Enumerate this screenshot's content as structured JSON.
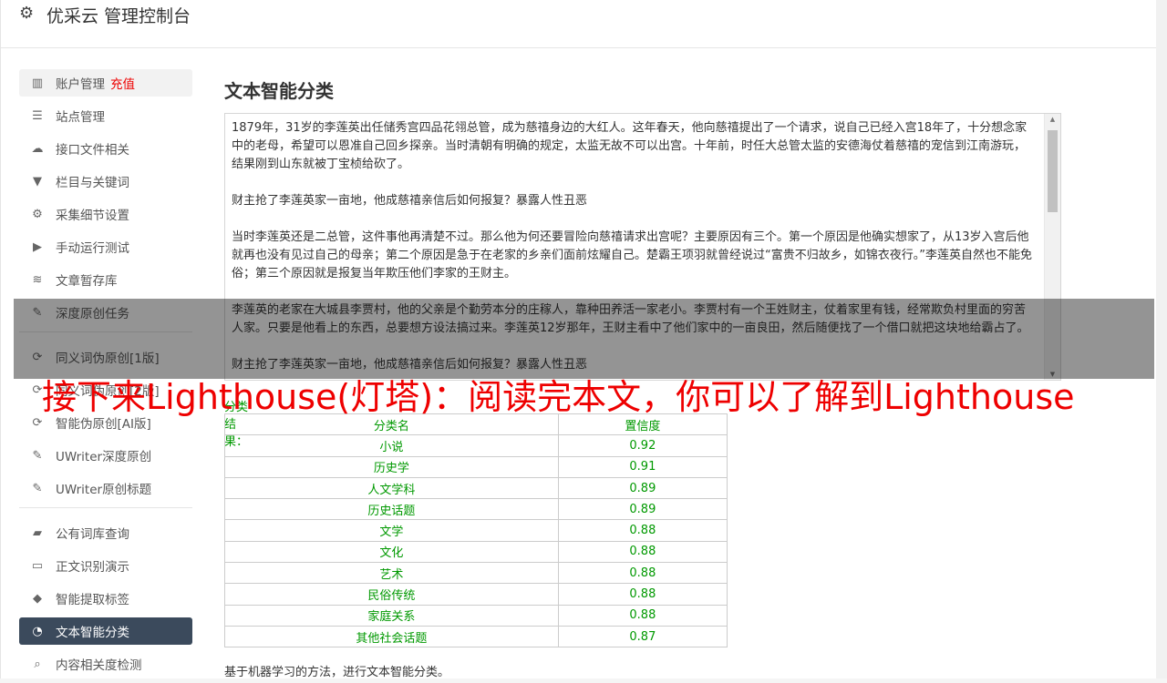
{
  "header": {
    "title": "优采云 管理控制台",
    "icon": "gear-icon"
  },
  "sidebar": {
    "groups": [
      [
        {
          "label": "账户管理",
          "badge": "充值",
          "icon": "bar-chart-icon",
          "state": "hover"
        },
        {
          "label": "站点管理",
          "icon": "server-icon"
        },
        {
          "label": "接口文件相关",
          "icon": "cloud-upload-icon"
        },
        {
          "label": "栏目与关键词",
          "icon": "filter-icon"
        },
        {
          "label": "采集细节设置",
          "icon": "gears-icon"
        },
        {
          "label": "手动运行测试",
          "icon": "play-circle-icon"
        },
        {
          "label": "文章暂存库",
          "icon": "database-icon"
        },
        {
          "label": "深度原创任务",
          "icon": "edit-icon"
        }
      ],
      [
        {
          "label": "同义词伪原创[1版]",
          "icon": "refresh-icon"
        },
        {
          "label": "同义词伪原创[2版]",
          "icon": "refresh-icon"
        },
        {
          "label": "智能伪原创[AI版]",
          "icon": "refresh-icon"
        },
        {
          "label": "UWriter深度原创",
          "icon": "edit-icon"
        },
        {
          "label": "UWriter原创标题",
          "icon": "edit-icon"
        }
      ],
      [
        {
          "label": "公有词库查询",
          "icon": "book-icon"
        },
        {
          "label": "正文识别演示",
          "icon": "monitor-icon"
        },
        {
          "label": "智能提取标签",
          "icon": "tag-icon"
        },
        {
          "label": "文本智能分类",
          "icon": "pie-chart-icon",
          "state": "active"
        },
        {
          "label": "内容相关度检测",
          "icon": "search-icon"
        }
      ]
    ]
  },
  "main": {
    "title": "文本智能分类",
    "text_paragraphs": [
      "1879年，31岁的李莲英出任储秀宫四品花翎总管，成为慈禧身边的大红人。这年春天，他向慈禧提出了一个请求，说自己已经入宫18年了，十分想念家中的老母，希望可以恩准自己回乡探亲。当时清朝有明确的规定，太监无故不可以出宫。十年前，时任大总管太监的安德海仗着慈禧的宠信到江南游玩，结果刚到山东就被丁宝桢给砍了。",
      "财主抢了李莲英家一亩地，他成慈禧亲信后如何报复？暴露人性丑恶",
      "当时李莲英还是二总管，这件事他再清楚不过。那么他为何还要冒险向慈禧请求出宫呢？主要原因有三个。第一个原因是他确实想家了，从13岁入宫后他就再也没有见过自己的母亲；第二个原因是急于在老家的乡亲们面前炫耀自己。楚霸王项羽就曾经说过“富贵不归故乡，如锦衣夜行。”李莲英自然也不能免俗；第三个原因就是报复当年欺压他们李家的王财主。",
      "李莲英的老家在大城县李贾村，他的父亲是个勤劳本分的庄稼人，靠种田养活一家老小。李贾村有一个王姓财主，仗着家里有钱，经常欺负村里面的穷苦人家。只要是他看上的东西，总要想方设法搞过来。李莲英12岁那年，王财主看中了他们家中的一亩良田，然后随便找了一个借口就把这块地给霸占了。",
      "财主抢了李莲英家一亩地，他成慈禧亲信后如何报复？暴露人性丑恶"
    ],
    "result_label": "分类结果：",
    "table": {
      "headers": [
        "分类名",
        "置信度"
      ],
      "rows": [
        [
          "小说",
          "0.92"
        ],
        [
          "历史学",
          "0.91"
        ],
        [
          "人文学科",
          "0.89"
        ],
        [
          "历史话题",
          "0.89"
        ],
        [
          "文学",
          "0.88"
        ],
        [
          "文化",
          "0.88"
        ],
        [
          "艺术",
          "0.88"
        ],
        [
          "民俗传统",
          "0.88"
        ],
        [
          "家庭关系",
          "0.88"
        ],
        [
          "其他社会话题",
          "0.87"
        ]
      ]
    },
    "footnote": "基于机器学习的方法，进行文本智能分类。"
  },
  "overlay_banner": "接下来Lighthouse(灯塔)：阅读完本文，你可以了解到Lighthouse",
  "colors": {
    "active_nav": "#3b4a5c",
    "result_green": "#009900",
    "badge_red": "#ee0000",
    "banner_red": "#ee0000"
  }
}
